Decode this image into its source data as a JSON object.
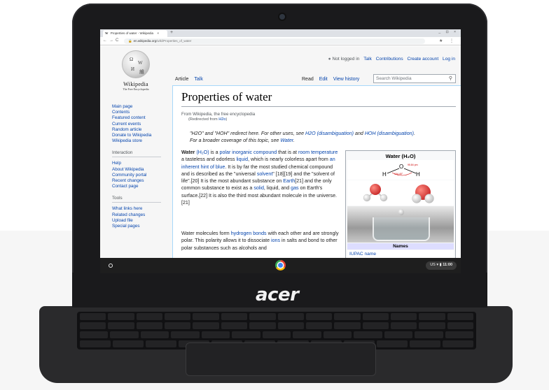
{
  "browser": {
    "tab_title": "Properties of water - Wikipedia",
    "tab_close": "×",
    "new_tab": "+",
    "window_controls": "_ ⊡ ×",
    "back": "←",
    "forward": "→",
    "reload": "C",
    "url_host": "en.wikipedia.org",
    "url_path": "/wiki/Properties_of_water"
  },
  "wiki": {
    "wordmark": "Wikipedia",
    "tagline": "The Free Encyclopedia",
    "sidebar_main": [
      "Main page",
      "Contents",
      "Featured content",
      "Current events",
      "Random article",
      "Donate to Wikipedia",
      "Wikipedia store"
    ],
    "interaction_heading": "Interaction",
    "sidebar_interaction": [
      "Help",
      "About Wikipedia",
      "Community portal",
      "Recent changes",
      "Contact page"
    ],
    "tools_heading": "Tools",
    "sidebar_tools": [
      "What links here",
      "Related changes",
      "Upload file",
      "Special pages"
    ],
    "not_logged_in": "Not logged in",
    "user_links": [
      "Talk",
      "Contributions",
      "Create account",
      "Log in"
    ],
    "tabs_left": [
      "Article",
      "Talk"
    ],
    "tabs_right": [
      "Read",
      "Edit",
      "View history"
    ],
    "search_placeholder": "Search Wikipedia",
    "title": "Properties of water",
    "from_wiki": "From Wikipedia, the free encyclopedia",
    "redirected_prefix": "(Redirected from ",
    "redirected_link": "H2o",
    "redirected_suffix": ")",
    "hatnote_1": "\"H2O\" and \"HOH\" redirect here. For other uses, see ",
    "hatnote_link_1": "H2O (disambiguation)",
    "hatnote_2": " and ",
    "hatnote_link_2": "HOH (disambiguation)",
    "hatnote_3": ".",
    "hatnote_line2": "For a broader coverage of this topic, see ",
    "hatnote_link_3": "Water",
    "para1_html_parts": {
      "bold": "Water",
      "formula": "(H₂O)",
      "t1": " is a ",
      "l1": "polar inorganic compound",
      "t2": " that is at ",
      "l2": "room temperature",
      "t3": " a tasteless and odorless ",
      "l3": "liquid",
      "t4": ", which is nearly colorless apart from ",
      "l4": "an inherent hint of blue",
      "t5": ". It is by far the most studied chemical compound and is described as the \"universal ",
      "l5": "solvent",
      "t6": "\" [18][19] and the \"solvent of life\".[20] It is the most abundant substance on ",
      "l6": "Earth",
      "t7": "[21] and the only common substance to exist as a ",
      "l7": "solid",
      "t8": ", liquid, and ",
      "l8": "gas",
      "t9": " on Earth's surface.[22] It is also the third most abundant molecule in the universe.[21]"
    },
    "para2_parts": {
      "t1": "Water molecules form ",
      "l1": "hydrogen bonds",
      "t2": " with each other and are strongly polar. This polarity allows it to dissociate ",
      "l2": "ions",
      "t3": " in salts and bond to other polar substances such as alcohols and"
    },
    "infobox": {
      "title": "Water (H₂O)",
      "diagram_o": "O",
      "diagram_h": "H",
      "bond_length": "95.84 pm",
      "bond_angle": "104.45°",
      "names_header": "Names",
      "iupac_label": "IUPAC name"
    }
  },
  "shelf": {
    "locale": "US",
    "time": "11:00"
  },
  "laptop": {
    "brand": "acer"
  }
}
